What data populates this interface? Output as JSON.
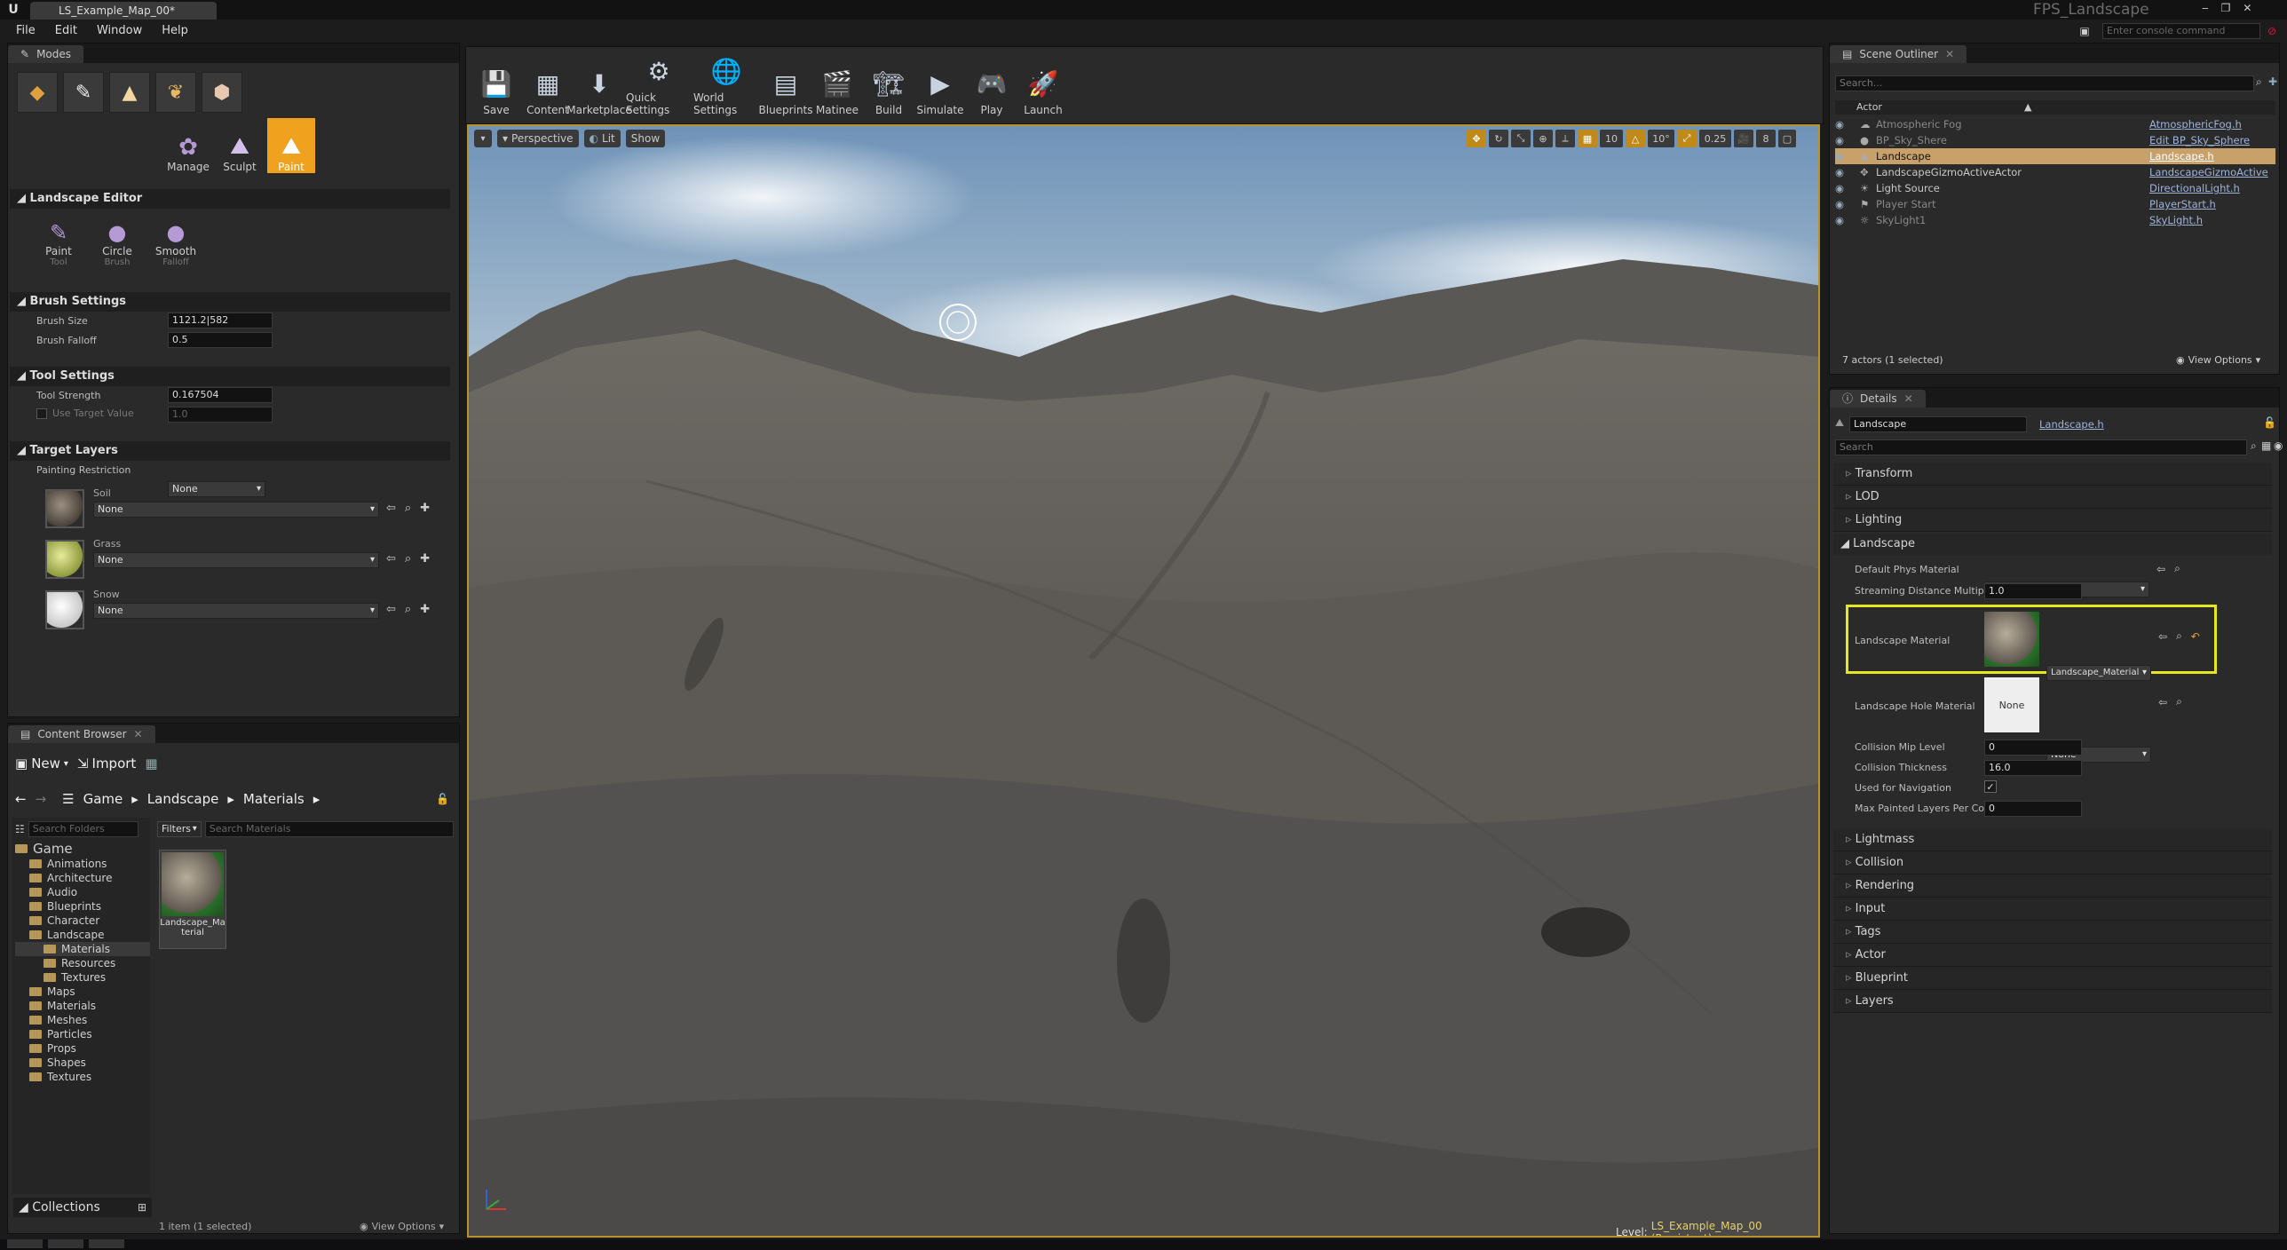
{
  "window": {
    "tab_title": "LS_Example_Map_00*",
    "project": "FPS_Landscape",
    "console_placeholder": "Enter console command"
  },
  "menu": [
    "File",
    "Edit",
    "Window",
    "Help"
  ],
  "modes": {
    "tab": "Modes",
    "sub_modes": [
      {
        "label": "Manage"
      },
      {
        "label": "Sculpt"
      },
      {
        "label": "Paint"
      }
    ],
    "landscape_editor": "Landscape Editor",
    "tools": [
      {
        "label": "Paint",
        "sub": "Tool"
      },
      {
        "label": "Circle",
        "sub": "Brush"
      },
      {
        "label": "Smooth",
        "sub": "Falloff"
      }
    ],
    "brush_settings": {
      "title": "Brush Settings",
      "brush_size_label": "Brush Size",
      "brush_size": "1121.2|582",
      "brush_falloff_label": "Brush Falloff",
      "brush_falloff": "0.5"
    },
    "tool_settings": {
      "title": "Tool Settings",
      "tool_strength_label": "Tool Strength",
      "tool_strength": "0.167504",
      "use_target_label": "Use Target Value",
      "target_value": "1.0"
    },
    "target_layers": {
      "title": "Target Layers",
      "painting_restriction_label": "Painting Restriction",
      "painting_restriction": "None",
      "layers": [
        {
          "name": "Soil",
          "value": "None"
        },
        {
          "name": "Grass",
          "value": "None"
        },
        {
          "name": "Snow",
          "value": "None"
        }
      ]
    }
  },
  "content_browser": {
    "tab": "Content Browser",
    "new_label": "New",
    "import_label": "Import",
    "path": [
      "Game",
      "Landscape",
      "Materials"
    ],
    "search_folders": "Search Folders",
    "filters": "Filters",
    "search_materials": "Search Materials",
    "tree": [
      {
        "label": "Game",
        "depth": 0
      },
      {
        "label": "Animations",
        "depth": 1
      },
      {
        "label": "Architecture",
        "depth": 1
      },
      {
        "label": "Audio",
        "depth": 1
      },
      {
        "label": "Blueprints",
        "depth": 1
      },
      {
        "label": "Character",
        "depth": 1
      },
      {
        "label": "Landscape",
        "depth": 1
      },
      {
        "label": "Materials",
        "depth": 2
      },
      {
        "label": "Resources",
        "depth": 2
      },
      {
        "label": "Textures",
        "depth": 2
      },
      {
        "label": "Maps",
        "depth": 1
      },
      {
        "label": "Materials",
        "depth": 1
      },
      {
        "label": "Meshes",
        "depth": 1
      },
      {
        "label": "Particles",
        "depth": 1
      },
      {
        "label": "Props",
        "depth": 1
      },
      {
        "label": "Shapes",
        "depth": 1
      },
      {
        "label": "Textures",
        "depth": 1
      }
    ],
    "asset": "Landscape_Material",
    "collections": "Collections",
    "status": "1 item (1 selected)",
    "view_options": "View Options"
  },
  "toolbar": [
    {
      "label": "Save"
    },
    {
      "label": "Content"
    },
    {
      "label": "Marketplace"
    },
    {
      "label": "Quick Settings"
    },
    {
      "label": "World Settings"
    },
    {
      "label": "Blueprints"
    },
    {
      "label": "Matinee"
    },
    {
      "label": "Build"
    },
    {
      "label": "Simulate"
    },
    {
      "label": "Play"
    },
    {
      "label": "Launch"
    }
  ],
  "viewport": {
    "perspective": "Perspective",
    "lit": "Lit",
    "show": "Show",
    "grid_snap": "10",
    "rot_snap": "10°",
    "scale_snap": "0.25",
    "cam_speed": "8",
    "level_label": "Level:",
    "level": "LS_Example_Map_00 (Persistent)"
  },
  "outliner": {
    "tab": "Scene Outliner",
    "search": "Search...",
    "col_actor": "Actor",
    "rows": [
      {
        "name": "Atmospheric Fog",
        "type": "AtmosphericFog.h"
      },
      {
        "name": "BP_Sky_Shere",
        "type": "Edit BP_Sky_Sphere"
      },
      {
        "name": "Landscape",
        "type": "Landscape.h"
      },
      {
        "name": "LandscapeGizmoActiveActor",
        "type": "LandscapeGizmoActive"
      },
      {
        "name": "Light Source",
        "type": "DirectionalLight.h"
      },
      {
        "name": "Player Start",
        "type": "PlayerStart.h"
      },
      {
        "name": "SkyLight1",
        "type": "SkyLight.h"
      }
    ],
    "footer": "7 actors (1 selected)",
    "view_options": "View Options"
  },
  "details": {
    "tab": "Details",
    "name": "Landscape",
    "class": "Landscape.h",
    "search": "Search",
    "sections_top": [
      "Transform",
      "LOD",
      "Lighting"
    ],
    "landscape_section": "Landscape",
    "props": {
      "default_phys_label": "Default Phys Material",
      "default_phys": "None",
      "streaming_label": "Streaming Distance Multiplie",
      "streaming": "1.0",
      "landscape_material_label": "Landscape Material",
      "landscape_material": "Landscape_Material",
      "hole_material_label": "Landscape Hole Material",
      "hole_thumb": "None",
      "hole_material": "None",
      "collision_mip_label": "Collision Mip Level",
      "collision_mip": "0",
      "collision_thickness_label": "Collision Thickness",
      "collision_thickness": "16.0",
      "navigation_label": "Used for Navigation",
      "max_layers_label": "Max Painted Layers Per Con",
      "max_layers": "0"
    },
    "sections_bottom": [
      "Lightmass",
      "Collision",
      "Rendering",
      "Input",
      "Tags",
      "Actor",
      "Blueprint",
      "Layers"
    ]
  },
  "colors": {
    "accent": "#f0a21e",
    "highlight": "#e6e61e",
    "selected_row": "#c8a06a"
  }
}
